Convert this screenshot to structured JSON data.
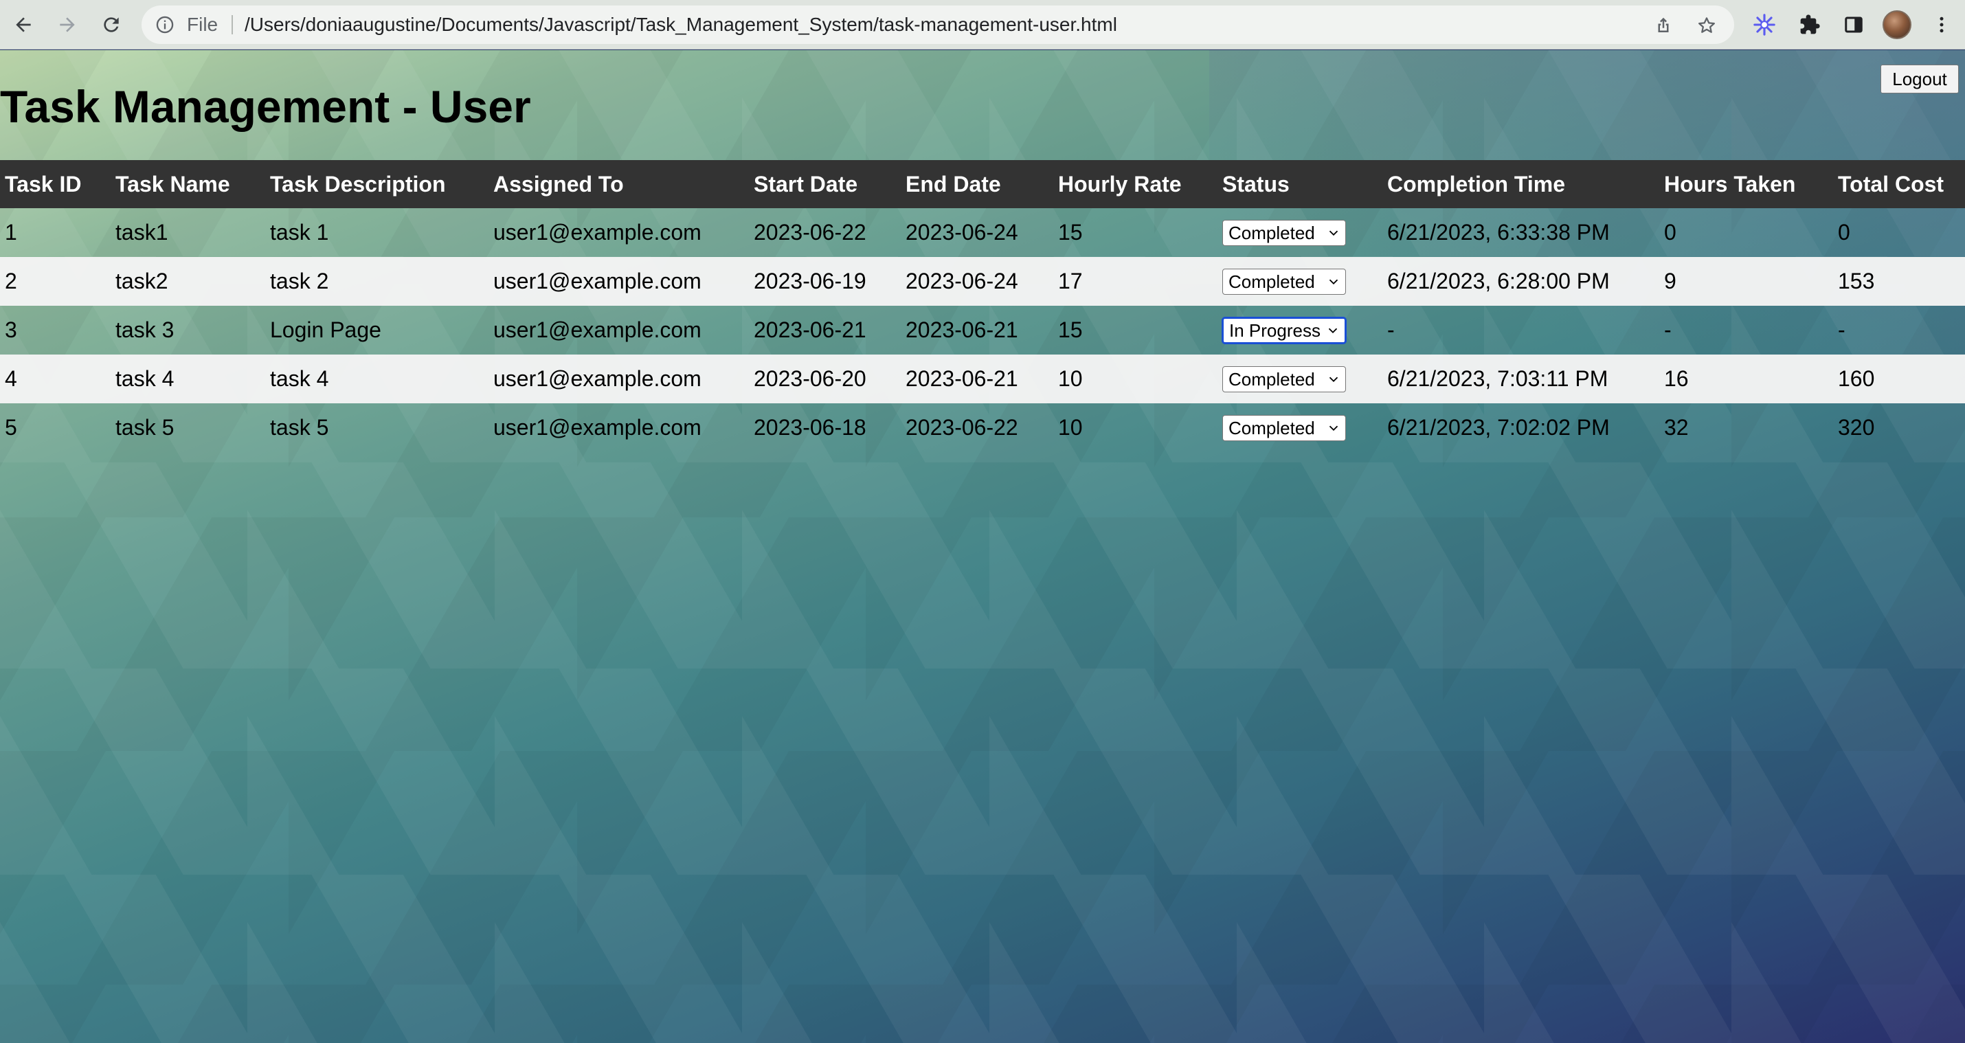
{
  "browser": {
    "file_label": "File",
    "url": "/Users/doniaaugustine/Documents/Javascript/Task_Management_System/task-management-user.html",
    "icons": [
      "back-icon",
      "forward-icon",
      "reload-icon",
      "info-icon",
      "share-icon",
      "star-icon",
      "extension-snowflake-icon",
      "puzzle-icon",
      "sidepanel-icon",
      "profile-avatar",
      "menu-icon"
    ]
  },
  "page": {
    "title": "Task Management - User",
    "logout_label": "Logout"
  },
  "table": {
    "headers": [
      "Task ID",
      "Task Name",
      "Task Description",
      "Assigned To",
      "Start Date",
      "End Date",
      "Hourly Rate",
      "Status",
      "Completion Time",
      "Hours Taken",
      "Total Cost"
    ],
    "rows": [
      {
        "id": "1",
        "name": "task1",
        "description": "task 1",
        "assigned_to": "user1@example.com",
        "start": "2023-06-22",
        "end": "2023-06-24",
        "rate": "15",
        "status": "Completed",
        "completion": "6/21/2023, 6:33:38 PM",
        "hours": "0",
        "cost": "0"
      },
      {
        "id": "2",
        "name": "task2",
        "description": "task 2",
        "assigned_to": "user1@example.com",
        "start": "2023-06-19",
        "end": "2023-06-24",
        "rate": "17",
        "status": "Completed",
        "completion": "6/21/2023, 6:28:00 PM",
        "hours": "9",
        "cost": "153"
      },
      {
        "id": "3",
        "name": "task 3",
        "description": "Login Page",
        "assigned_to": "user1@example.com",
        "start": "2023-06-21",
        "end": "2023-06-21",
        "rate": "15",
        "status": "In Progress",
        "completion": "-",
        "hours": "-",
        "cost": "-"
      },
      {
        "id": "4",
        "name": "task 4",
        "description": "task 4",
        "assigned_to": "user1@example.com",
        "start": "2023-06-20",
        "end": "2023-06-21",
        "rate": "10",
        "status": "Completed",
        "completion": "6/21/2023, 7:03:11 PM",
        "hours": "16",
        "cost": "160"
      },
      {
        "id": "5",
        "name": "task 5",
        "description": "task 5",
        "assigned_to": "user1@example.com",
        "start": "2023-06-18",
        "end": "2023-06-22",
        "rate": "10",
        "status": "Completed",
        "completion": "6/21/2023, 7:02:02 PM",
        "hours": "32",
        "cost": "320"
      }
    ]
  },
  "colors": {
    "header_bg": "#333333",
    "focus_ring": "#1a4fd6",
    "extension_accent": "#5b5bf0"
  }
}
